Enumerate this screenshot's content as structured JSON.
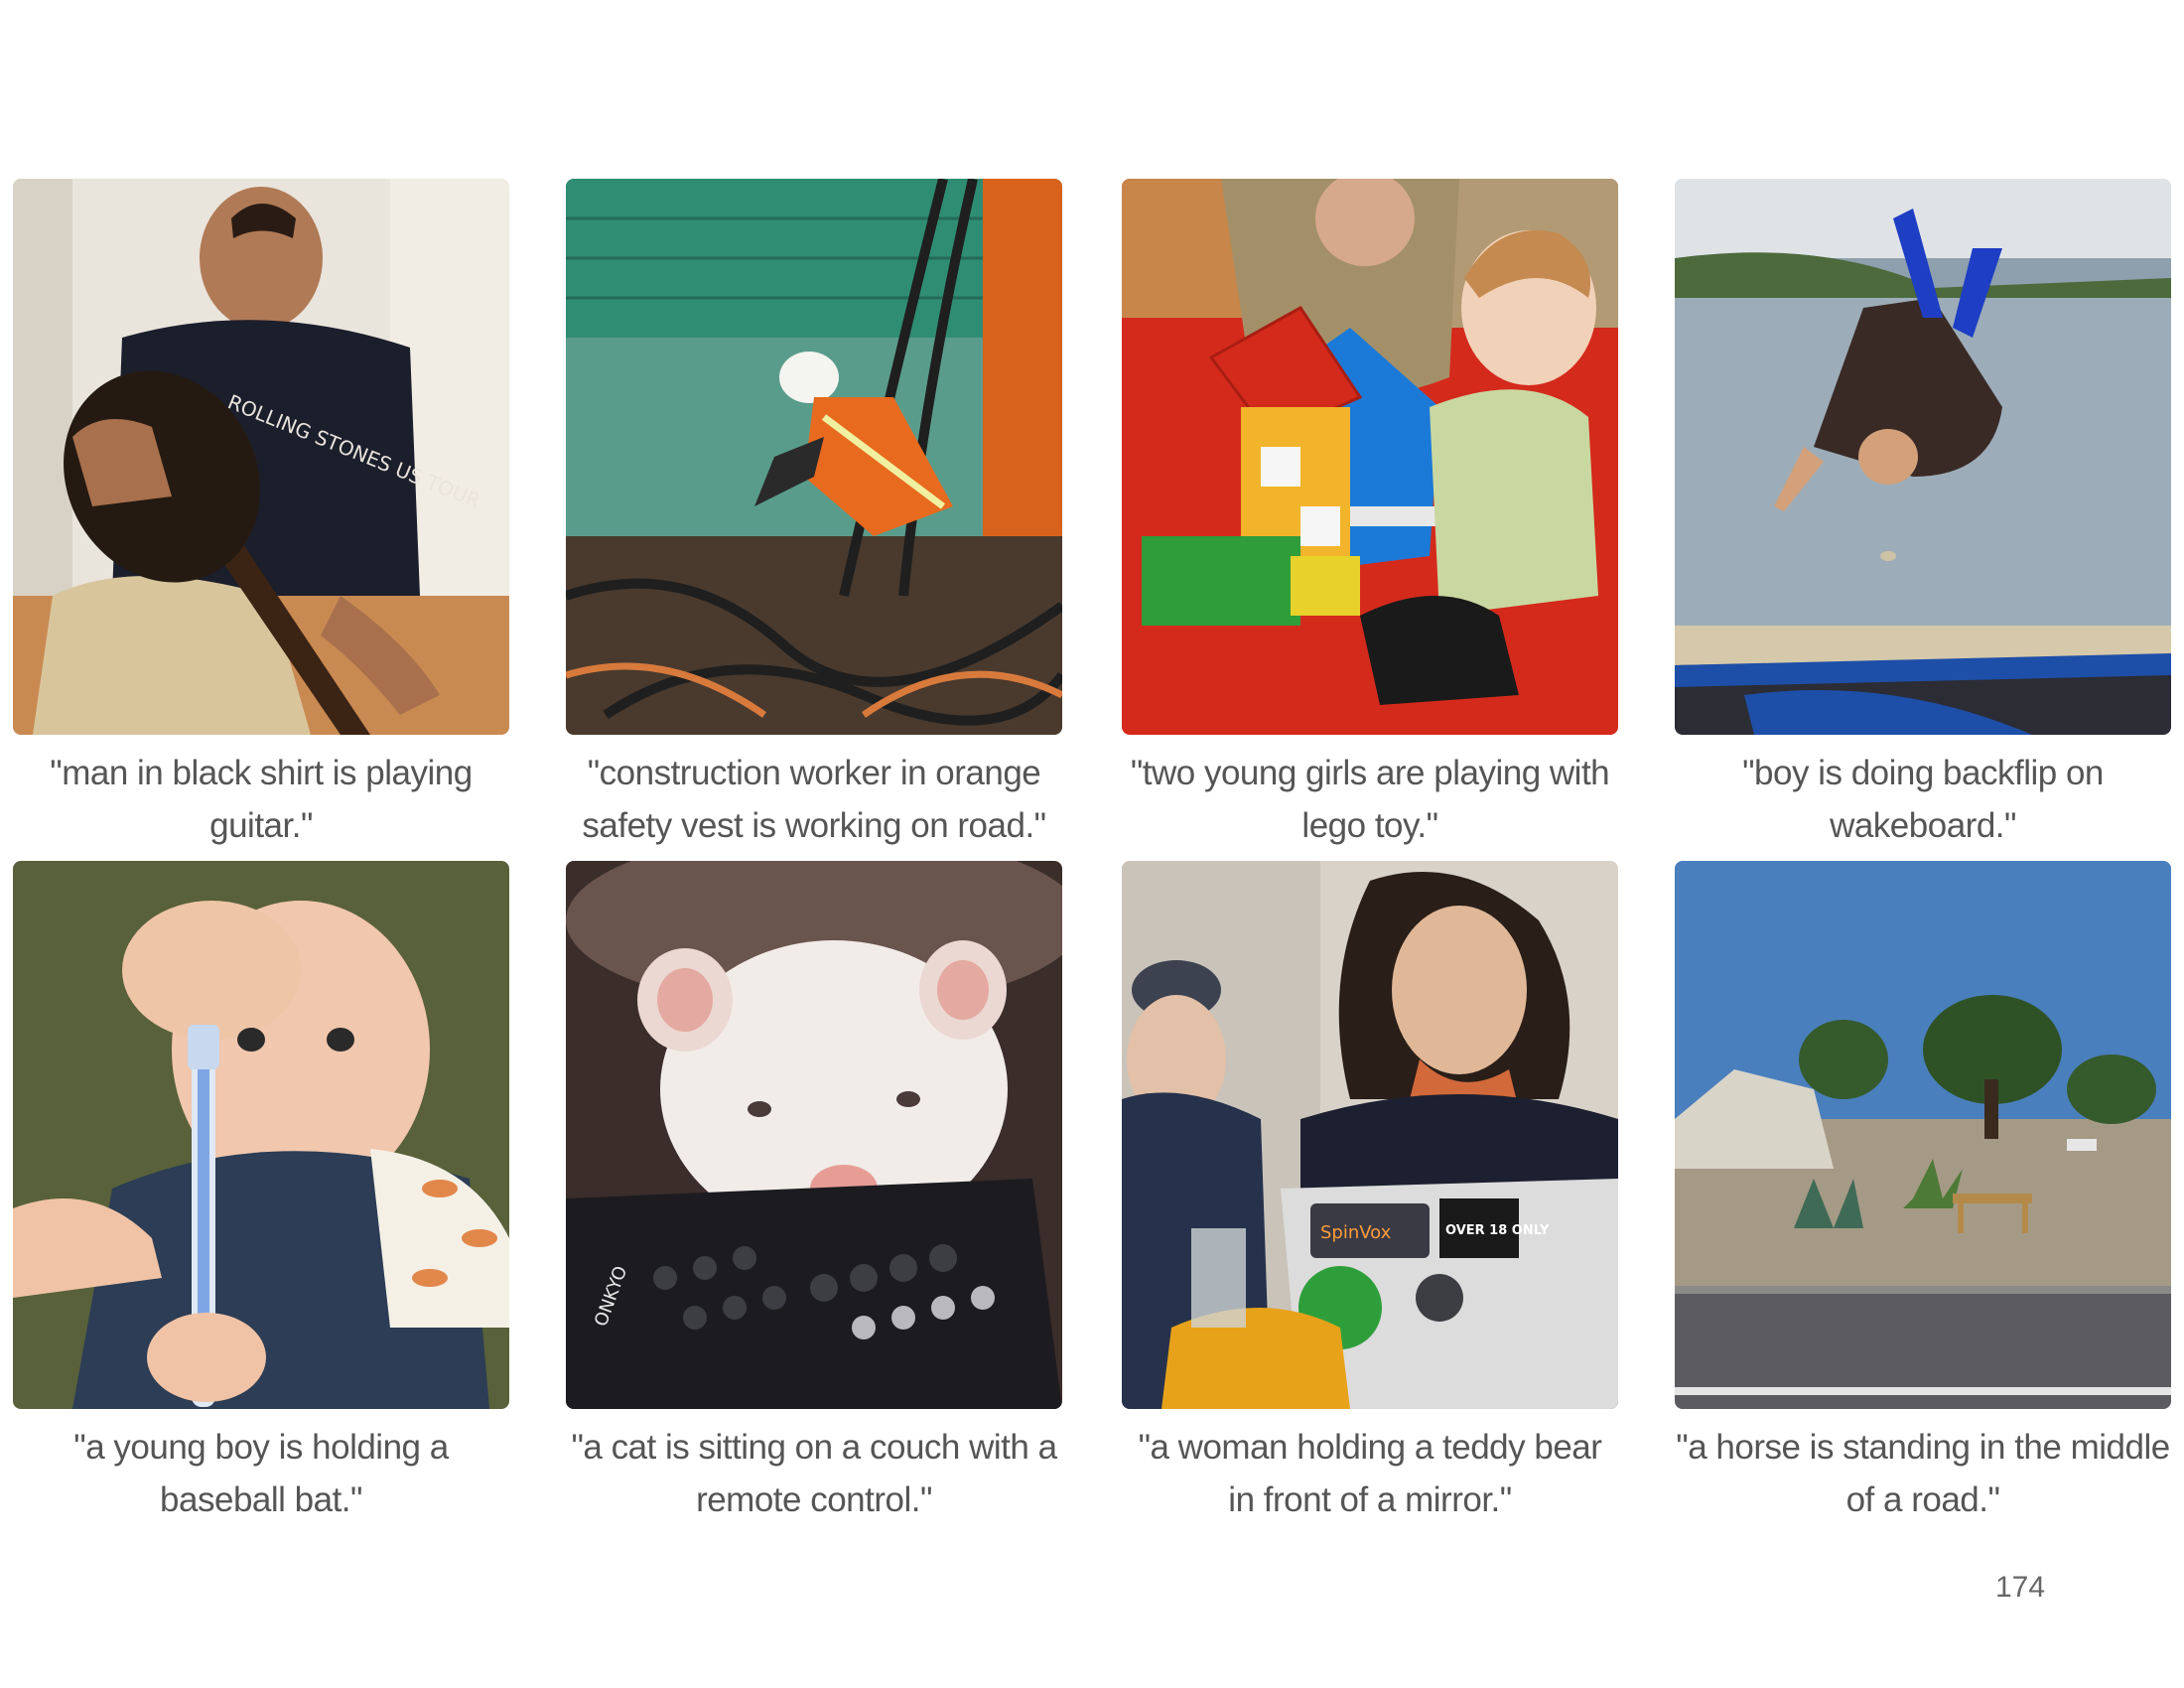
{
  "tiles": [
    {
      "caption": "\"man in black shirt is playing guitar.\"",
      "image": "man-playing-guitar"
    },
    {
      "caption": "\"construction worker in orange safety vest is working on road.\"",
      "image": "construction-worker"
    },
    {
      "caption": "\"two young girls are playing with lego toy.\"",
      "image": "child-with-lego"
    },
    {
      "caption": "\"boy is doing backflip on wakeboard.\"",
      "image": "backflip-trampoline"
    },
    {
      "caption": "\"a young boy is holding a baseball bat.\"",
      "image": "baby-with-toothbrush"
    },
    {
      "caption": "\"a cat is sitting on a couch with a remote control.\"",
      "image": "ferret-on-remote"
    },
    {
      "caption": "\"a woman holding a teddy bear in front of a mirror.\"",
      "image": "people-with-laptop"
    },
    {
      "caption": "\"a horse is standing in the middle of a road.\"",
      "image": "roadside-landscape"
    }
  ],
  "laptop_stickers": [
    "SpinVox",
    "OVER 18 ONLY"
  ],
  "remote_brand": "ONKYO",
  "shirt_text": "ROLLING STONES US TOUR",
  "page_number": "174"
}
